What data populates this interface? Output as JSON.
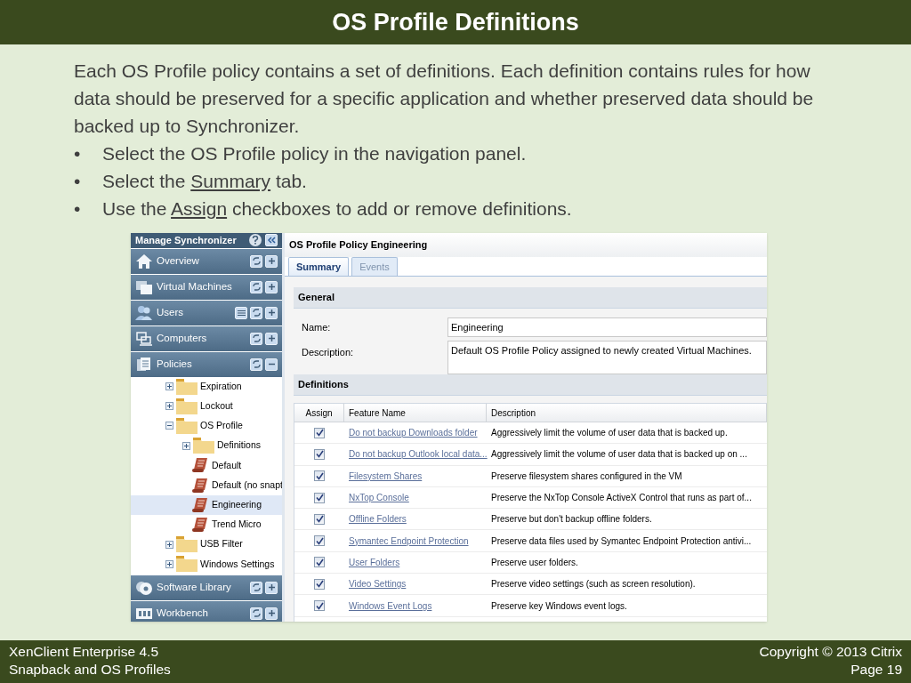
{
  "slide": {
    "title": "OS Profile Definitions",
    "intro": "Each OS Profile policy contains a set of definitions.  Each definition contains rules for how data should be preserved for a specific application and whether preserved data should be backed up to Synchronizer.",
    "bullets": [
      {
        "marker": "•",
        "before": "Select the OS Profile policy in the navigation panel."
      },
      {
        "marker": "•",
        "before": "Select the ",
        "link": "Summary",
        "after": " tab."
      },
      {
        "marker": "•",
        "before": "Use the ",
        "link": "Assign",
        "after": " checkboxes to add or remove definitions."
      }
    ]
  },
  "sidebar": {
    "title": "Manage Synchronizer",
    "sections": [
      {
        "label": "Overview",
        "expanded": false,
        "list_button": false
      },
      {
        "label": "Virtual Machines",
        "expanded": false,
        "list_button": false
      },
      {
        "label": "Users",
        "expanded": false,
        "list_button": true
      },
      {
        "label": "Computers",
        "expanded": false,
        "list_button": false
      },
      {
        "label": "Policies",
        "expanded": true,
        "list_button": false,
        "tree": [
          {
            "kind": "folder",
            "label": "Expiration",
            "expanded": false,
            "selected": false
          },
          {
            "kind": "folder",
            "label": "Lockout",
            "expanded": false,
            "selected": false
          },
          {
            "kind": "folder",
            "label": "OS Profile",
            "expanded": true,
            "selected": false,
            "children": [
              {
                "kind": "folder",
                "label": "Definitions",
                "expanded": false,
                "selected": false
              },
              {
                "kind": "policy",
                "label": "Default",
                "selected": false
              },
              {
                "kind": "policy",
                "label": "Default (no snapt",
                "selected": false
              },
              {
                "kind": "policy",
                "label": "Engineering",
                "selected": true
              },
              {
                "kind": "policy",
                "label": "Trend Micro",
                "selected": false
              }
            ]
          },
          {
            "kind": "folder",
            "label": "USB Filter",
            "expanded": false,
            "selected": false
          },
          {
            "kind": "folder",
            "label": "Windows Settings",
            "expanded": false,
            "selected": false
          }
        ]
      },
      {
        "label": "Software Library",
        "expanded": false,
        "list_button": false
      },
      {
        "label": "Workbench",
        "expanded": false,
        "list_button": false
      }
    ]
  },
  "main": {
    "title": "OS Profile Policy Engineering",
    "tabs": [
      {
        "label": "Summary",
        "selected": true
      },
      {
        "label": "Events",
        "selected": false
      }
    ],
    "general": {
      "heading": "General",
      "name_label": "Name:",
      "name_value": "Engineering",
      "description_label": "Description:",
      "description_value": "Default OS Profile Policy assigned to newly created Virtual Machines."
    },
    "definitions": {
      "heading": "Definitions",
      "columns": [
        "Assign",
        "Feature Name",
        "Description"
      ],
      "rows": [
        {
          "checked": true,
          "name": "Do not backup Downloads folder",
          "description": "Aggressively limit the volume of user data that is backed up."
        },
        {
          "checked": true,
          "name": "Do not backup Outlook local data...",
          "description": "Aggressively limit the volume of user data that is backed up on ..."
        },
        {
          "checked": true,
          "name": "Filesystem Shares",
          "description": "Preserve filesystem shares configured in the VM"
        },
        {
          "checked": true,
          "name": "NxTop Console",
          "description": "Preserve the NxTop Console ActiveX Control that runs as part of..."
        },
        {
          "checked": true,
          "name": "Offline Folders",
          "description": "Preserve but don't backup offline folders."
        },
        {
          "checked": true,
          "name": "Symantec Endpoint Protection",
          "description": "Preserve data files used by Symantec Endpoint Protection antivi..."
        },
        {
          "checked": true,
          "name": "User Folders",
          "description": "Preserve user folders."
        },
        {
          "checked": true,
          "name": "Video Settings",
          "description": "Preserve video settings (such as screen resolution)."
        },
        {
          "checked": true,
          "name": "Windows Event Logs",
          "description": "Preserve key Windows event logs."
        }
      ]
    }
  },
  "footer": {
    "left": [
      "XenClient Enterprise 4.5",
      "Snapback and OS Profiles"
    ],
    "right": [
      "Copyright © 2013 Citrix",
      "Page 19"
    ]
  }
}
